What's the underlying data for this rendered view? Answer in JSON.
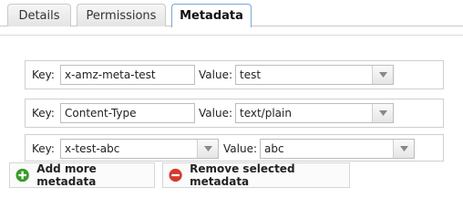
{
  "tabs": [
    {
      "label": "Details",
      "active": false
    },
    {
      "label": "Permissions",
      "active": false
    },
    {
      "label": "Metadata",
      "active": true
    }
  ],
  "rows": [
    {
      "key_label": "Key:",
      "key": "x-amz-meta-test",
      "value_label": "Value:",
      "value": "test"
    },
    {
      "key_label": "Key:",
      "key": "Content-Type",
      "value_label": "Value:",
      "value": "text/plain"
    },
    {
      "key_label": "Key:",
      "key": "x-test-abc",
      "value_label": "Value:",
      "value": "abc"
    }
  ],
  "buttons": {
    "add": "Add more metadata",
    "remove": "Remove selected metadata"
  },
  "colors": {
    "add_icon": "#3a9a2a",
    "remove_icon": "#d23b2e"
  }
}
